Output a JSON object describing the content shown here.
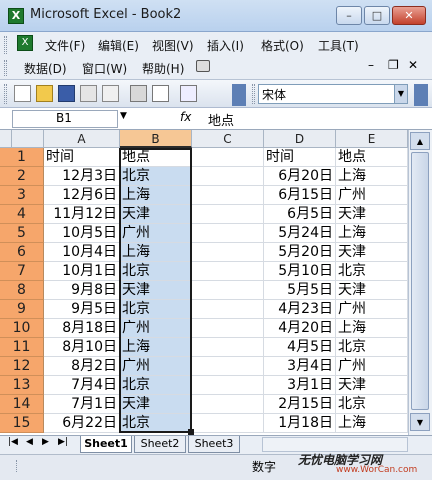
{
  "window": {
    "title": "Microsoft Excel - Book2",
    "min": "–",
    "max": "□",
    "close": "✕"
  },
  "menubar": {
    "items": [
      "文件(F)",
      "编辑(E)",
      "视图(V)",
      "插入(I)",
      "格式(O)",
      "工具(T)",
      "数据(D)",
      "窗口(W)",
      "帮助(H)"
    ],
    "doc_min": "–",
    "doc_restore": "❐",
    "doc_close": "✕"
  },
  "toolbar": {
    "font_name": "宋体"
  },
  "formula": {
    "name_box": "B1",
    "fx": "fx",
    "content": "地点"
  },
  "sheet": {
    "columns": [
      "A",
      "B",
      "C",
      "D",
      "E"
    ],
    "rows": [
      {
        "n": "1",
        "A": "时间",
        "B": "地点",
        "D": "时间",
        "E": "地点"
      },
      {
        "n": "2",
        "A": "12月3日",
        "B": "北京",
        "D": "6月20日",
        "E": "上海"
      },
      {
        "n": "3",
        "A": "12月6日",
        "B": "上海",
        "D": "6月15日",
        "E": "广州"
      },
      {
        "n": "4",
        "A": "11月12日",
        "B": "天津",
        "D": "6月5日",
        "E": "天津"
      },
      {
        "n": "5",
        "A": "10月5日",
        "B": "广州",
        "D": "5月24日",
        "E": "上海"
      },
      {
        "n": "6",
        "A": "10月4日",
        "B": "上海",
        "D": "5月20日",
        "E": "天津"
      },
      {
        "n": "7",
        "A": "10月1日",
        "B": "北京",
        "D": "5月10日",
        "E": "北京"
      },
      {
        "n": "8",
        "A": "9月8日",
        "B": "天津",
        "D": "5月5日",
        "E": "天津"
      },
      {
        "n": "9",
        "A": "9月5日",
        "B": "北京",
        "D": "4月23日",
        "E": "广州"
      },
      {
        "n": "10",
        "A": "8月18日",
        "B": "广州",
        "D": "4月20日",
        "E": "上海"
      },
      {
        "n": "11",
        "A": "8月10日",
        "B": "上海",
        "D": "4月5日",
        "E": "北京"
      },
      {
        "n": "12",
        "A": "8月2日",
        "B": "广州",
        "D": "3月4日",
        "E": "广州"
      },
      {
        "n": "13",
        "A": "7月4日",
        "B": "北京",
        "D": "3月1日",
        "E": "天津"
      },
      {
        "n": "14",
        "A": "7月1日",
        "B": "天津",
        "D": "2月15日",
        "E": "北京"
      },
      {
        "n": "15",
        "A": "6月22日",
        "B": "北京",
        "D": "1月18日",
        "E": "上海"
      }
    ]
  },
  "tabs": {
    "items": [
      "Sheet1",
      "Sheet2",
      "Sheet3"
    ]
  },
  "status": {
    "mode": "数字",
    "watermark": "无忧电脑学习网",
    "watermark_url": "www.WorCan.com"
  },
  "colors": {
    "row_header": "#f6a66b",
    "selection": "#c9dcf0",
    "title_bar": "#b9d1ee"
  }
}
